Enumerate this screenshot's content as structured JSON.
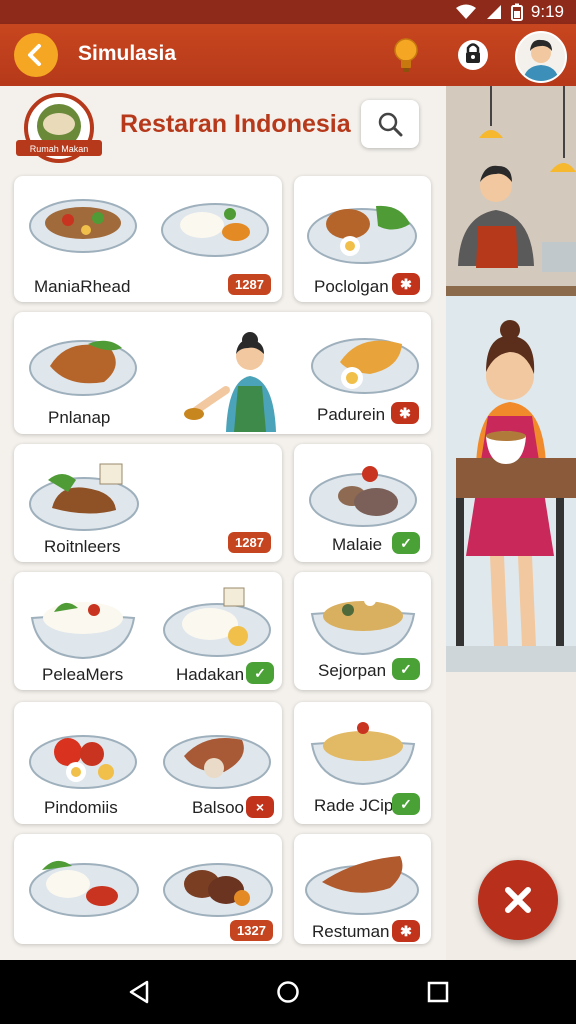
{
  "statusbar": {
    "time": "9:19"
  },
  "appbar": {
    "title": "Simulasia"
  },
  "header": {
    "title": "Restaran Indonesia",
    "logo_text": "Rumah Makan"
  },
  "cards": [
    {
      "label": "ManiaRhead",
      "badge": "1287"
    },
    {
      "label": "Poclolgan",
      "badge_icon": "snowflake-icon"
    },
    {
      "label": "Pnlanap"
    },
    {
      "label": "Padurein",
      "badge_icon": "snowflake-icon"
    },
    {
      "label": "Roitnleers",
      "badge": "1287"
    },
    {
      "label": "Malaie",
      "badge_icon": "check-icon"
    },
    {
      "label": "PeleaMers"
    },
    {
      "label": "Hadakan",
      "badge_icon": "check-icon"
    },
    {
      "label": "Sejorpan",
      "badge_icon": "check-icon"
    },
    {
      "label": "Pindomiis"
    },
    {
      "label": "Balsoo",
      "badge_icon": "close-icon"
    },
    {
      "label": "Rade JCip",
      "badge_icon": "check-icon"
    },
    {
      "label": "1327"
    },
    {
      "label": "Restuman",
      "badge_icon": "snowflake-icon"
    }
  ],
  "colors": {
    "brand": "#b5391a",
    "accent": "#f5a623",
    "success": "#4aa135",
    "danger": "#c2331c"
  }
}
